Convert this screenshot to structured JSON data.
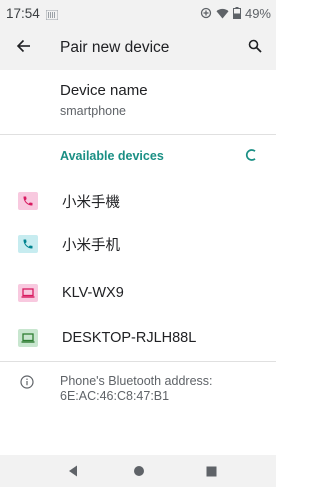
{
  "status_bar": {
    "time": "17:54",
    "battery": "49%"
  },
  "app_bar": {
    "title": "Pair new device"
  },
  "device_name": {
    "title": "Device name",
    "value": "smartphone"
  },
  "available": {
    "header": "Available devices",
    "devices": [
      {
        "label": "小米手機",
        "icon": "phone-icon",
        "icon_bg": "#f8c9df",
        "icon_color": "#d81b60"
      },
      {
        "label": "小米手机",
        "icon": "phone-icon",
        "icon_bg": "#c7ecf0",
        "icon_color": "#00838f"
      },
      {
        "label": "KLV-WX9",
        "icon": "laptop-icon",
        "icon_bg": "#f8c9df",
        "icon_color": "#d81b60"
      },
      {
        "label": "DESKTOP-RJLH88L",
        "icon": "laptop-icon",
        "icon_bg": "#c8e6cf",
        "icon_color": "#2e7d32"
      }
    ]
  },
  "info": {
    "text_line1": "Phone's Bluetooth address:",
    "text_line2": "6E:AC:46:C8:47:B1"
  },
  "colors": {
    "accent": "#1a8f84",
    "bar_bg": "#f2f2f2"
  }
}
